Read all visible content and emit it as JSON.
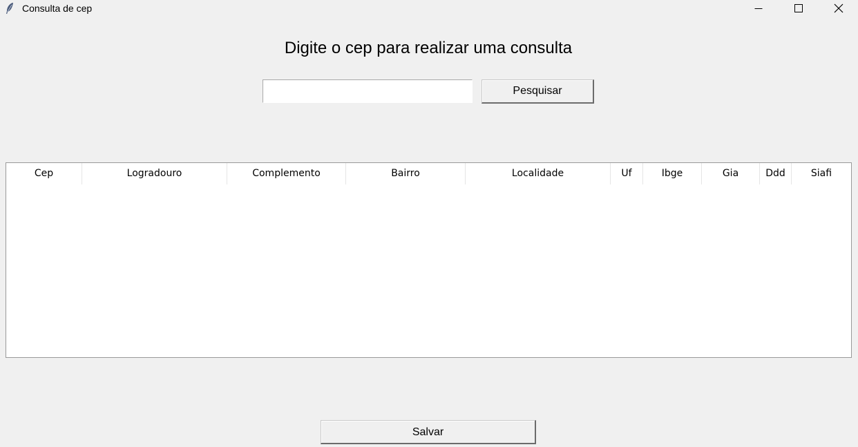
{
  "window": {
    "title": "Consulta de cep"
  },
  "heading": "Digite o cep para realizar uma consulta",
  "search": {
    "value": "",
    "button_label": "Pesquisar"
  },
  "table": {
    "columns": [
      "Cep",
      "Logradouro",
      "Complemento",
      "Bairro",
      "Localidade",
      "Uf",
      "Ibge",
      "Gia",
      "Ddd",
      "Siafi"
    ],
    "rows": []
  },
  "save_button_label": "Salvar",
  "icons": {
    "app": "feather-icon",
    "minimize": "minimize-icon",
    "maximize": "maximize-icon",
    "close": "close-icon"
  }
}
